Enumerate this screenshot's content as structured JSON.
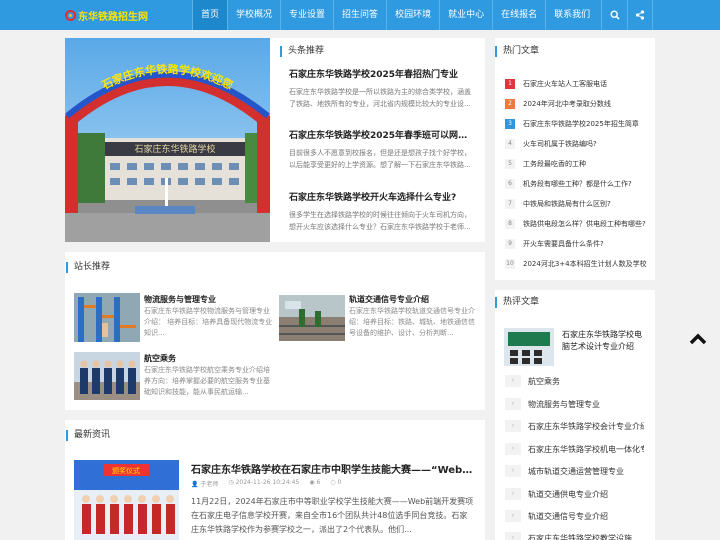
{
  "site": {
    "logo_text": "东华铁路招生网"
  },
  "nav": {
    "items": [
      {
        "label": "首页",
        "active": true
      },
      {
        "label": "学校概况"
      },
      {
        "label": "专业设置"
      },
      {
        "label": "招生问答"
      },
      {
        "label": "校园环境"
      },
      {
        "label": "就业中心"
      },
      {
        "label": "在线报名"
      },
      {
        "label": "联系我们"
      }
    ],
    "search_icon": "search-icon",
    "share_icon": "share-icon"
  },
  "hero": {
    "gate_banner": "石家庄东华铁路学校欢迎您",
    "building_sign": "石家庄东华铁路学校"
  },
  "headlines": {
    "title": "头条推荐",
    "items": [
      {
        "title": "石家庄东华铁路学校2025年春招热门专业",
        "summary": "石家庄东华铁路学校是一所以铁路为主的综合类学校，涵盖了铁路、地铁所有的专业，河北省内规模比较大的专业设..."
      },
      {
        "title": "石家庄东华铁路学校2025年春季班可以网上报名吗",
        "summary": "目前很多人不愿意到校报名，但是还是想孩子找个好学校，以后能享受更好的上学资源。想了解一下石家庄东华铁路..."
      },
      {
        "title": "石家庄东华铁路学校开火车选择什么专业?",
        "summary": "很多学生在选择铁路学校的时候往往倾向于火车司机方向，想开火车应该选择什么专业？石家庄东华铁路学校于老师..."
      }
    ]
  },
  "recommend": {
    "title": "站长推荐",
    "items": [
      {
        "title": "物流服务与管理专业",
        "summary": "石家庄东华铁路学校物流服务与管理专业介绍： 培养目标：培养具备现代物流专业知识..."
      },
      {
        "title": "轨道交通信号专业介绍",
        "summary": "石家庄东华铁路学校轨道交通信号专业介绍：培养目标：铁路、城轨、地铁通信信号设备的维护、设计、分析判断..."
      },
      {
        "title": "航空乘务",
        "summary": "石家庄东华铁路学校航空乘务专业介绍培养方向：培养掌握必要的航空服务专业基础知识和技能，能从事民航运输..."
      }
    ]
  },
  "news": {
    "title": "最新资讯",
    "item": {
      "title": "石家庄东华铁路学校在石家庄市中职学生技能大赛——“Web前端开发”项目中获佳绩",
      "author": "于老师",
      "date": "2024-11-26 10:24:45",
      "views": "6",
      "comments": "0",
      "summary": "11月22日，2024年石家庄市中等职业学校学生技能大赛——Web前端开发赛项在石家庄电子信息学校开赛，来自全市16个团队共计48位选手同台竞技。石家庄东华铁路学校作为参赛学校之一，派出了2个代表队。他们...",
      "thumb_banner": "颁奖仪式"
    }
  },
  "hot": {
    "title": "热门文章",
    "items": [
      {
        "num": "1",
        "text": "石家庄火车站人工客服电话"
      },
      {
        "num": "2",
        "text": "2024年河北中考录取分数线"
      },
      {
        "num": "3",
        "text": "石家庄东华铁路学校2025年招生简章"
      },
      {
        "num": "4",
        "text": "火车司机属于铁路编吗?"
      },
      {
        "num": "5",
        "text": "工务段最吃香的工种"
      },
      {
        "num": "6",
        "text": "机务段有哪些工种？都是什么工作?"
      },
      {
        "num": "7",
        "text": "中铁局和铁路局有什么区别?"
      },
      {
        "num": "8",
        "text": "铁路供电段怎么样？供电段工种有哪些?"
      },
      {
        "num": "9",
        "text": "开火车需要具备什么条件?"
      },
      {
        "num": "10",
        "text": "2024河北3+4本科招生计划人数及学校"
      }
    ],
    "colors": {
      "n1": "#e0353a",
      "n2": "#ef7a3a",
      "n3": "#3593d8"
    }
  },
  "reviews": {
    "title": "热评文章",
    "top": {
      "title": "石家庄东华铁路学校电脑艺术设计专业介绍"
    },
    "items": [
      {
        "text": "航空乘务"
      },
      {
        "text": "物流服务与管理专业"
      },
      {
        "text": "石家庄东华铁路学校会计专业介绍"
      },
      {
        "text": "石家庄东华铁路学校机电一体化专业"
      },
      {
        "text": "城市轨道交通运营管理专业"
      },
      {
        "text": "轨道交通供电专业介绍"
      },
      {
        "text": "轨道交通信号专业介绍"
      },
      {
        "text": "石家庄东华铁路学校教学设施"
      }
    ]
  },
  "colors": {
    "primary": "#2f9ae0",
    "logo": "#ffe400"
  }
}
